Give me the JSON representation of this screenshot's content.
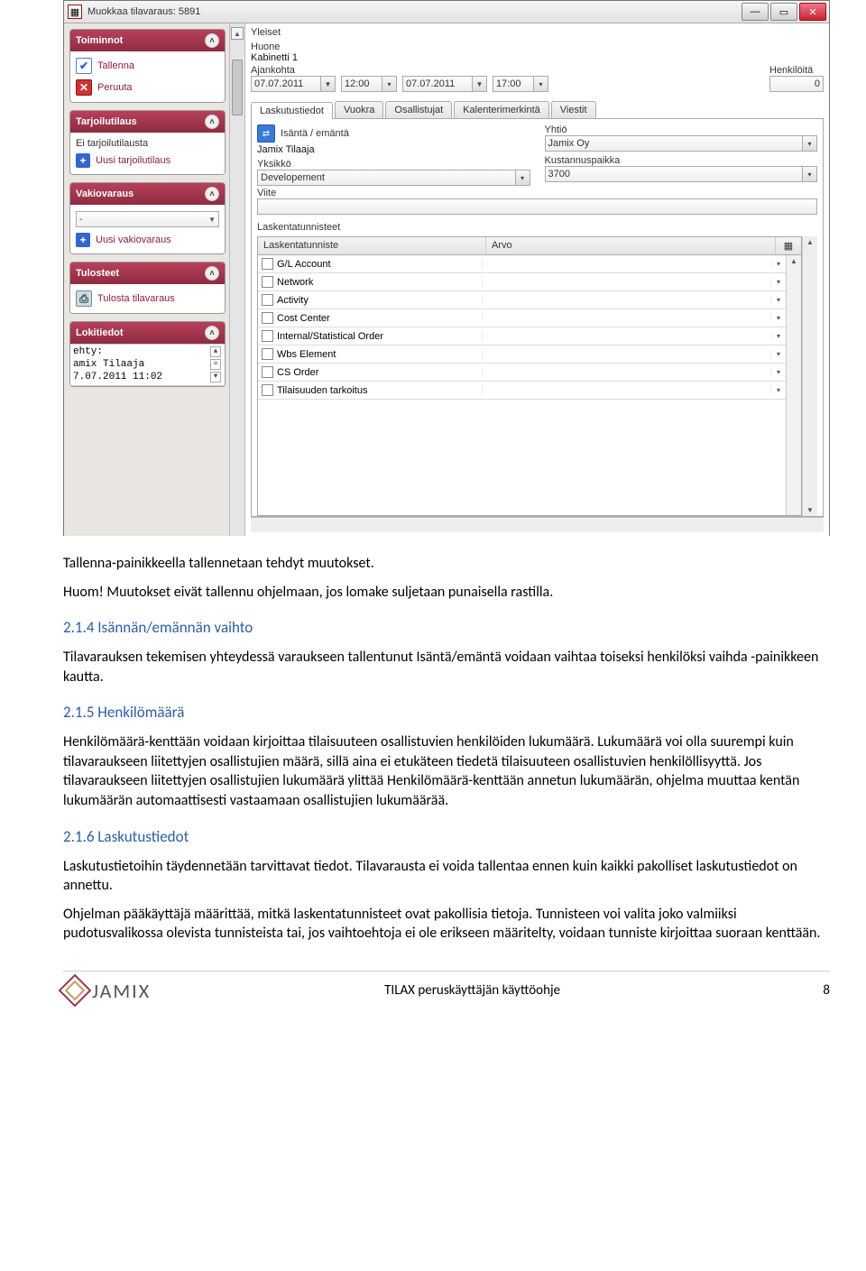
{
  "window": {
    "title": "Muokkaa tilavaraus: 5891"
  },
  "sidebar": {
    "panels": {
      "toiminnot": {
        "title": "Toiminnot",
        "save": "Tallenna",
        "cancel": "Peruuta"
      },
      "tarjoilu": {
        "title": "Tarjoilutilaus",
        "none": "Ei tarjoilutilausta",
        "new": "Uusi tarjoilutilaus"
      },
      "vakio": {
        "title": "Vakiovaraus",
        "combo": "-",
        "new": "Uusi vakiovaraus"
      },
      "tulosteet": {
        "title": "Tulosteet",
        "print": "Tulosta tilavaraus"
      },
      "loki": {
        "title": "Lokitiedot",
        "text": "ehty:\namix Tilaaja\n7.07.2011 11:02"
      }
    }
  },
  "main": {
    "yleiset": "Yleiset",
    "huone_label": "Huone",
    "huone_value": "Kabinetti 1",
    "ajankohta_label": "Ajankohta",
    "date_from": "07.07.2011",
    "time_from": "12:00",
    "date_to": "07.07.2011",
    "time_to": "17:00",
    "henkiloita_label": "Henkilöitä",
    "henkiloita_value": "0",
    "tabs": [
      "Laskutustiedot",
      "Vuokra",
      "Osallistujat",
      "Kalenterimerkintä",
      "Viestit"
    ],
    "isanta_label": "Isäntä / emäntä",
    "isanta_value": "Jamix Tilaaja",
    "yhtio_label": "Yhtiö",
    "yhtio_value": "Jamix Oy",
    "yksikko_label": "Yksikkö",
    "yksikko_value": "Developement",
    "kust_label": "Kustannuspaikka",
    "kust_value": "3700",
    "viite_label": "Viite",
    "viite_value": "",
    "lask_label": "Laskentatunnisteet",
    "grid": {
      "col1": "Laskentatunniste",
      "col2": "Arvo",
      "rows": [
        "G/L Account",
        "Network",
        "Activity",
        "Cost Center",
        "Internal/Statistical Order",
        "Wbs Element",
        "CS Order",
        "Tilaisuuden tarkoitus"
      ]
    }
  },
  "doc": {
    "p1": "Tallenna-painikkeella tallennetaan tehdyt muutokset.",
    "p2": "Huom! Muutokset eivät tallennu ohjelmaan, jos lomake suljetaan punaisella rastilla.",
    "h214": "2.1.4 Isännän/emännän vaihto",
    "p3": "Tilavarauksen tekemisen yhteydessä varaukseen tallentunut Isäntä/emäntä voidaan vaihtaa toiseksi henkilöksi vaihda -painikkeen kautta.",
    "h215": "2.1.5 Henkilömäärä",
    "p4": "Henkilömäärä-kenttään voidaan kirjoittaa tilaisuuteen osallistuvien henkilöiden lukumäärä. Lukumäärä voi olla suurempi kuin tilavaraukseen liitettyjen osallistujien määrä, sillä aina ei etukäteen tiedetä tilaisuuteen osallistuvien henkilöllisyyttä. Jos tilavaraukseen liitettyjen osallistujien lukumäärä ylittää Henkilömäärä-kenttään annetun lukumäärän, ohjelma muuttaa kentän lukumäärän automaattisesti vastaamaan osallistujien lukumäärää.",
    "h216": "2.1.6 Laskutustiedot",
    "p5": "Laskutustietoihin täydennetään tarvittavat tiedot. Tilavarausta ei voida tallentaa ennen kuin kaikki pakolliset laskutustiedot on annettu.",
    "p6": "Ohjelman pääkäyttäjä määrittää, mitkä laskentatunnisteet ovat pakollisia tietoja. Tunnisteen voi valita joko valmiiksi pudotusvalikossa olevista tunnisteista tai, jos vaihtoehtoja ei ole erikseen määritelty, voidaan tunniste kirjoittaa suoraan kenttään."
  },
  "footer": {
    "brand": "JAMIX",
    "title": "TILAX peruskäyttäjän käyttöohje",
    "page": "8"
  }
}
